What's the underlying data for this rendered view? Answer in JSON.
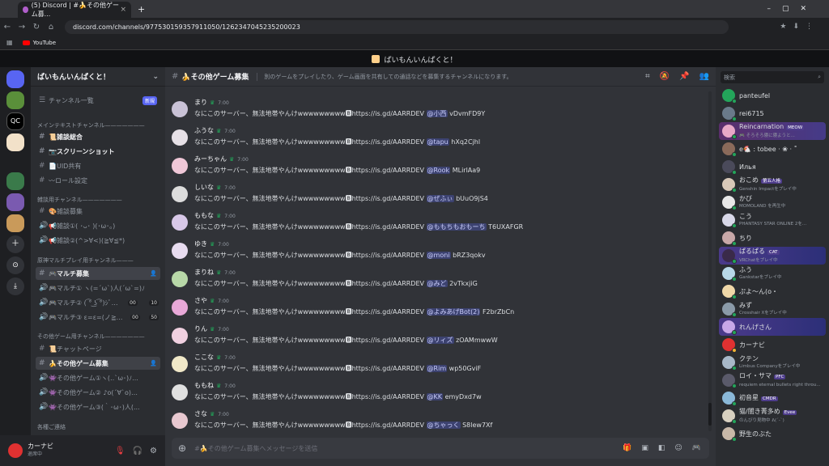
{
  "browser": {
    "tab_title": "(5) Discord | #🍌その他ゲーム募...",
    "tab_close": "×",
    "new_tab": "+",
    "url": "discord.com/channels/977530159357911050/1262347045235200023",
    "bookmark_youtube": "YouTube"
  },
  "app_title": "ぱいもんいんぱくと！",
  "server": {
    "name": "ぱいもんいんぱくと！",
    "channel_list_label": "チャンネル一覧",
    "new_label": "新規",
    "categories": [
      {
        "label": "メインテキストチャンネル———————"
      },
      {
        "label": "雑談用チャンネル———————"
      },
      {
        "label": "原神マルチプレイ用チャンネル———"
      },
      {
        "label": "その他ゲーム用チャンネル———————"
      },
      {
        "label": "各種ご連絡"
      }
    ],
    "channels": [
      {
        "name": "📜雑談総合"
      },
      {
        "name": "📷スクリーンショット"
      },
      {
        "name": "📄UID共有"
      },
      {
        "name": "〰ロール設定"
      },
      {
        "name": "🎨雑談募集"
      },
      {
        "name": "📢雑談①( ･ᴗ･ )(･ω･。)"
      },
      {
        "name": "📢雑談②(^>∀<)(≧∀≦*)"
      },
      {
        "name": "🎮マルチ募集"
      },
      {
        "name": "🎮マルチ① ヽ(=´ω`)人(´ω`=)ﾉ"
      },
      {
        "name": "🎮マルチ② ( ͡° ͜ʖ ͡°)ｼﾞ…"
      },
      {
        "name": "🎮マルチ③ ε=ε=(ノ≧…"
      },
      {
        "name": "📜チャットページ"
      },
      {
        "name": "🍌その他ゲーム募集"
      },
      {
        "name": "👾その他ゲーム①ヽ(‥`ω･)ﾉ..."
      },
      {
        "name": "👾その他ゲーム② ♪o(´∀`o)…"
      },
      {
        "name": "👾その他ゲーム③(｀･ω･)人(..."
      }
    ],
    "voice_counts": {
      "m2a": "00",
      "m2b": "10",
      "m3a": "00",
      "m3b": "50"
    }
  },
  "user": {
    "name": "カーナビ",
    "status": "退席中"
  },
  "channel_header": {
    "name": "🍌その他ゲーム募集",
    "topic": "別のゲームをプレイしたり、ゲーム画面を共有しての通話などを募集するチャンネルになります。"
  },
  "messages": [
    {
      "author": "まり",
      "time": "7:00",
      "text": "なにこのサーバー、無法地帯やんけwwwwwwwww🅱https://is.gd/AARRDEV ",
      "mention": "@小西",
      "tail": " vDvmFD9Y"
    },
    {
      "author": "ふうな",
      "time": "7:00",
      "text": "なにこのサーバー、無法地帯やんけwwwwwwwww🅱https://is.gd/AARRDEV ",
      "mention": "@tapu",
      "tail": " hXq2Cjhl"
    },
    {
      "author": "みーちゃん",
      "time": "7:00",
      "text": "なにこのサーバー、無法地帯やんけwwwwwwwww🅱https://is.gd/AARRDEV ",
      "mention": "@Rook",
      "tail": " MLirlAa9"
    },
    {
      "author": "しいな",
      "time": "7:00",
      "text": "なにこのサーバー、無法地帯やんけwwwwwwwww🅱https://is.gd/AARRDEV ",
      "mention": "@ぜふぃ",
      "tail": " bUuO9jS4"
    },
    {
      "author": "ももな",
      "time": "7:00",
      "text": "なにこのサーバー、無法地帯やんけwwwwwwwww🅱https://is.gd/AARRDEV ",
      "mention": "@ももちもおもーち",
      "tail": " T6UXAFGR"
    },
    {
      "author": "ゆき",
      "time": "7:00",
      "text": "なにこのサーバー、無法地帯やんけwwwwwwwww🅱https://is.gd/AARRDEV ",
      "mention": "@moni",
      "tail": " bRZ3qokv"
    },
    {
      "author": "まりね",
      "time": "7:00",
      "text": "なにこのサーバー、無法地帯やんけwwwwwwwww🅱https://is.gd/AARRDEV ",
      "mention": "@みど",
      "tail": " 2vTkxjiG"
    },
    {
      "author": "さや",
      "time": "7:00",
      "text": "なにこのサーバー、無法地帯やんけwwwwwwwww🅱https://is.gd/AARRDEV ",
      "mention": "@よみあげBot(2)",
      "tail": " F2brZbCn"
    },
    {
      "author": "りん",
      "time": "7:00",
      "text": "なにこのサーバー、無法地帯やんけwwwwwwwww🅱https://is.gd/AARRDEV ",
      "mention": "@リィズ",
      "tail": " zOAMmwwW"
    },
    {
      "author": "ここな",
      "time": "7:00",
      "text": "なにこのサーバー、無法地帯やんけwwwwwwwww🅱https://is.gd/AARRDEV ",
      "mention": "@Rim",
      "tail": " wp50GviF"
    },
    {
      "author": "ももね",
      "time": "7:00",
      "text": "なにこのサーバー、無法地帯やんけwwwwwwwww🅱https://is.gd/AARRDEV ",
      "mention": "@KK",
      "tail": " emyDxd7w"
    },
    {
      "author": "さな",
      "time": "7:00",
      "text": "なにこのサーバー、無法地帯やんけwwwwwwwww🅱https://is.gd/AARRDEV ",
      "mention": "@ちゃっく",
      "tail": " S8lew7Xf"
    }
  ],
  "composer_placeholder": "#🍌その他ゲーム募集へメッセージを送信",
  "members": {
    "search_placeholder": "検索",
    "list": [
      {
        "name": "panteufel",
        "activity": "",
        "tag": ""
      },
      {
        "name": "rei6715",
        "activity": "",
        "tag": ""
      },
      {
        "name": "Reincarnation",
        "activity": "🎮 そろそろ寝に寝ようと...",
        "tag": "MEOW"
      },
      {
        "name": "e🐔 : tobee · ❀ · ˚",
        "activity": "",
        "tag": ""
      },
      {
        "name": "Илья",
        "activity": "",
        "tag": ""
      },
      {
        "name": "おこめ",
        "activity": "Genshin Impactをプレイ中",
        "tag": "第五人格"
      },
      {
        "name": "かび",
        "activity": "MOMOLAND を再生中",
        "tag": ""
      },
      {
        "name": "こう",
        "activity": "PHANTASY STAR ONLINE 2を...",
        "tag": ""
      },
      {
        "name": "ちり",
        "activity": "",
        "tag": ""
      },
      {
        "name": "ぱるぱる",
        "activity": "VRChatをプレイ中",
        "tag": "CAT"
      },
      {
        "name": "ふう",
        "activity": "Gankstarをプレイ中",
        "tag": ""
      },
      {
        "name": "ぷよ〜ん(o・",
        "activity": "",
        "tag": ""
      },
      {
        "name": "みず",
        "activity": "Crosshair Xをプレイ中",
        "tag": ""
      },
      {
        "name": "れんげさん",
        "activity": "",
        "tag": ""
      },
      {
        "name": "カーナビ",
        "activity": "",
        "tag": ""
      },
      {
        "name": "クテン",
        "activity": "Limbus Companyをプレイ中",
        "tag": ""
      },
      {
        "name": "ロイ・サマ",
        "activity": "requiem eternal bullets right throu...",
        "tag": "PFC"
      },
      {
        "name": "初音星",
        "activity": "",
        "tag": "CMDR"
      },
      {
        "name": "猫/闇き菁多め",
        "activity": "のんびり見物中 ᕕ(⁠´⁠-⁠`⁠)",
        "tag": "Evee"
      },
      {
        "name": "野生のぶた",
        "activity": "",
        "tag": ""
      }
    ]
  }
}
